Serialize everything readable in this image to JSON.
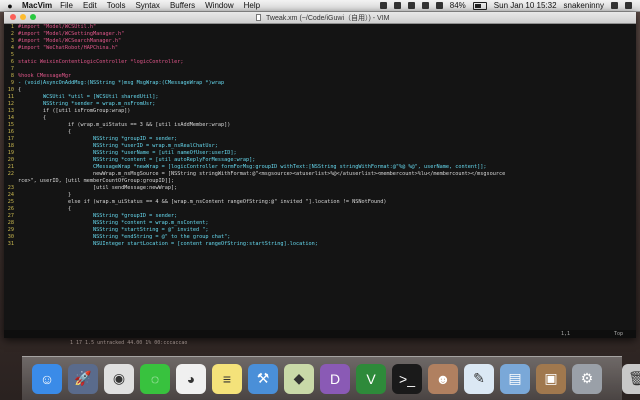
{
  "menubar": {
    "app": "MacVim",
    "menus": [
      "File",
      "Edit",
      "Tools",
      "Syntax",
      "Buffers",
      "Window",
      "Help"
    ],
    "battery": "84%",
    "clock": "Sun Jan 10  15:32",
    "user": "snakeninny"
  },
  "window": {
    "title": "Tweak.xm (~/Code/iGuwi（自用）) - VIM"
  },
  "editor": {
    "lines": [
      {
        "n": "1",
        "t": "#import \"Model/WCSUtil.h\""
      },
      {
        "n": "2",
        "t": "#import \"Model/WCSettingManager.h\""
      },
      {
        "n": "3",
        "t": "#import \"Model/WCSearchManager.h\""
      },
      {
        "n": "4",
        "t": "#import \"WeChatRobot/HAPChina.h\""
      },
      {
        "n": "5",
        "t": ""
      },
      {
        "n": "6",
        "t": "static WeixinContentLogicController *logicController;"
      },
      {
        "n": "7",
        "t": ""
      },
      {
        "n": "8",
        "t": "%hook CMessageMgr"
      },
      {
        "n": "9",
        "t": "- (void)AsyncOnAddMsg:(NSString *)msg MsgWrap:(CMessageWrap *)wrap"
      },
      {
        "n": "10",
        "t": "{"
      },
      {
        "n": "11",
        "t": "        WCSUtil *util = [WCSUtil sharedUtil];"
      },
      {
        "n": "12",
        "t": "        NSString *sender = wrap.m_nsFromUsr;"
      },
      {
        "n": "13",
        "t": "        if ([util isFromGroup:wrap])"
      },
      {
        "n": "14",
        "t": "        {"
      },
      {
        "n": "15",
        "t": "                if (wrap.m_uiStatus == 3 && [util isAddMember:wrap])"
      },
      {
        "n": "16",
        "t": "                {"
      },
      {
        "n": "17",
        "t": "                        NSString *groupID = sender;"
      },
      {
        "n": "18",
        "t": "                        NSString *userID = wrap.m_nsRealChatUsr;"
      },
      {
        "n": "19",
        "t": "                        NSString *userName = [util nameOfUser:userID];"
      },
      {
        "n": "20",
        "t": "                        NSString *content = [util autoReplyForMessage:wrap];"
      },
      {
        "n": "21",
        "t": "                        CMessageWrap *newWrap = [logicController formForMsg:groupID withText:[NSString stringWithFormat:@\"%@ %@\", userName, content]];"
      },
      {
        "n": "22",
        "t": "                        newWrap.m_nsMsgSource = [NSString stringWithFormat:@\"<msgsource><atuserlist>%@</atuserlist><membercount>%lu</membercount></msgsource"
      },
      {
        "n": "",
        "t": "rce>\", userID, [util memberCountOfGroup:groupID]];"
      },
      {
        "n": "23",
        "t": "                        [util sendMessage:newWrap];"
      },
      {
        "n": "24",
        "t": "                }"
      },
      {
        "n": "25",
        "t": "                else if (wrap.m_uiStatus == 4 && [wrap.m_nsContent rangeOfString:@\" invited \"].location != NSNotFound)"
      },
      {
        "n": "26",
        "t": "                {"
      },
      {
        "n": "27",
        "t": "                        NSString *groupID = sender;"
      },
      {
        "n": "28",
        "t": "                        NSString *content = wrap.m_nsContent;"
      },
      {
        "n": "29",
        "t": "                        NSString *startString = @\" invited \";"
      },
      {
        "n": "30",
        "t": "                        NSString *endString = @\" to the group chat\";"
      },
      {
        "n": "31",
        "t": "                        NSUInteger startLocation = [content rangeOfString:startString].location;"
      }
    ]
  },
  "statusline": {
    "position": "1,1",
    "percent": "Top"
  },
  "background_text": [
    "1 17 1.5 untracked  44.00 1% 00:cccaccao"
  ],
  "dock": {
    "items": [
      {
        "name": "finder-icon",
        "color": "#3a8be8",
        "glyph": "☺"
      },
      {
        "name": "launchpad-icon",
        "color": "#5a6b8c",
        "glyph": "🚀"
      },
      {
        "name": "chrome-icon",
        "color": "#e0e0e0",
        "glyph": "◉"
      },
      {
        "name": "wechat-icon",
        "color": "#38c23e",
        "glyph": "◌"
      },
      {
        "name": "qq-icon",
        "color": "#f0f0f0",
        "glyph": "◕"
      },
      {
        "name": "notes-icon",
        "color": "#f4e27a",
        "glyph": "≡"
      },
      {
        "name": "xcode-icon",
        "color": "#4a8fd8",
        "glyph": "⚒"
      },
      {
        "name": "maps-icon",
        "color": "#c9d9a8",
        "glyph": "◆"
      },
      {
        "name": "dash-icon",
        "color": "#8a5ab5",
        "glyph": "D"
      },
      {
        "name": "vim-icon",
        "color": "#2e8a3a",
        "glyph": "V"
      },
      {
        "name": "terminal-icon",
        "color": "#1a1a1a",
        "glyph": ">_"
      },
      {
        "name": "portrait-icon",
        "color": "#b08060",
        "glyph": "☻"
      },
      {
        "name": "textedit-icon",
        "color": "#dbe8f4",
        "glyph": "✎"
      },
      {
        "name": "preview-icon",
        "color": "#7aa8d8",
        "glyph": "▤"
      },
      {
        "name": "photos-icon",
        "color": "#a0784e",
        "glyph": "▣"
      },
      {
        "name": "system-preferences-icon",
        "color": "#9aa0a8",
        "glyph": "⚙"
      },
      {
        "name": "trash-icon",
        "color": "#c8c8c8",
        "glyph": "🗑"
      }
    ]
  }
}
